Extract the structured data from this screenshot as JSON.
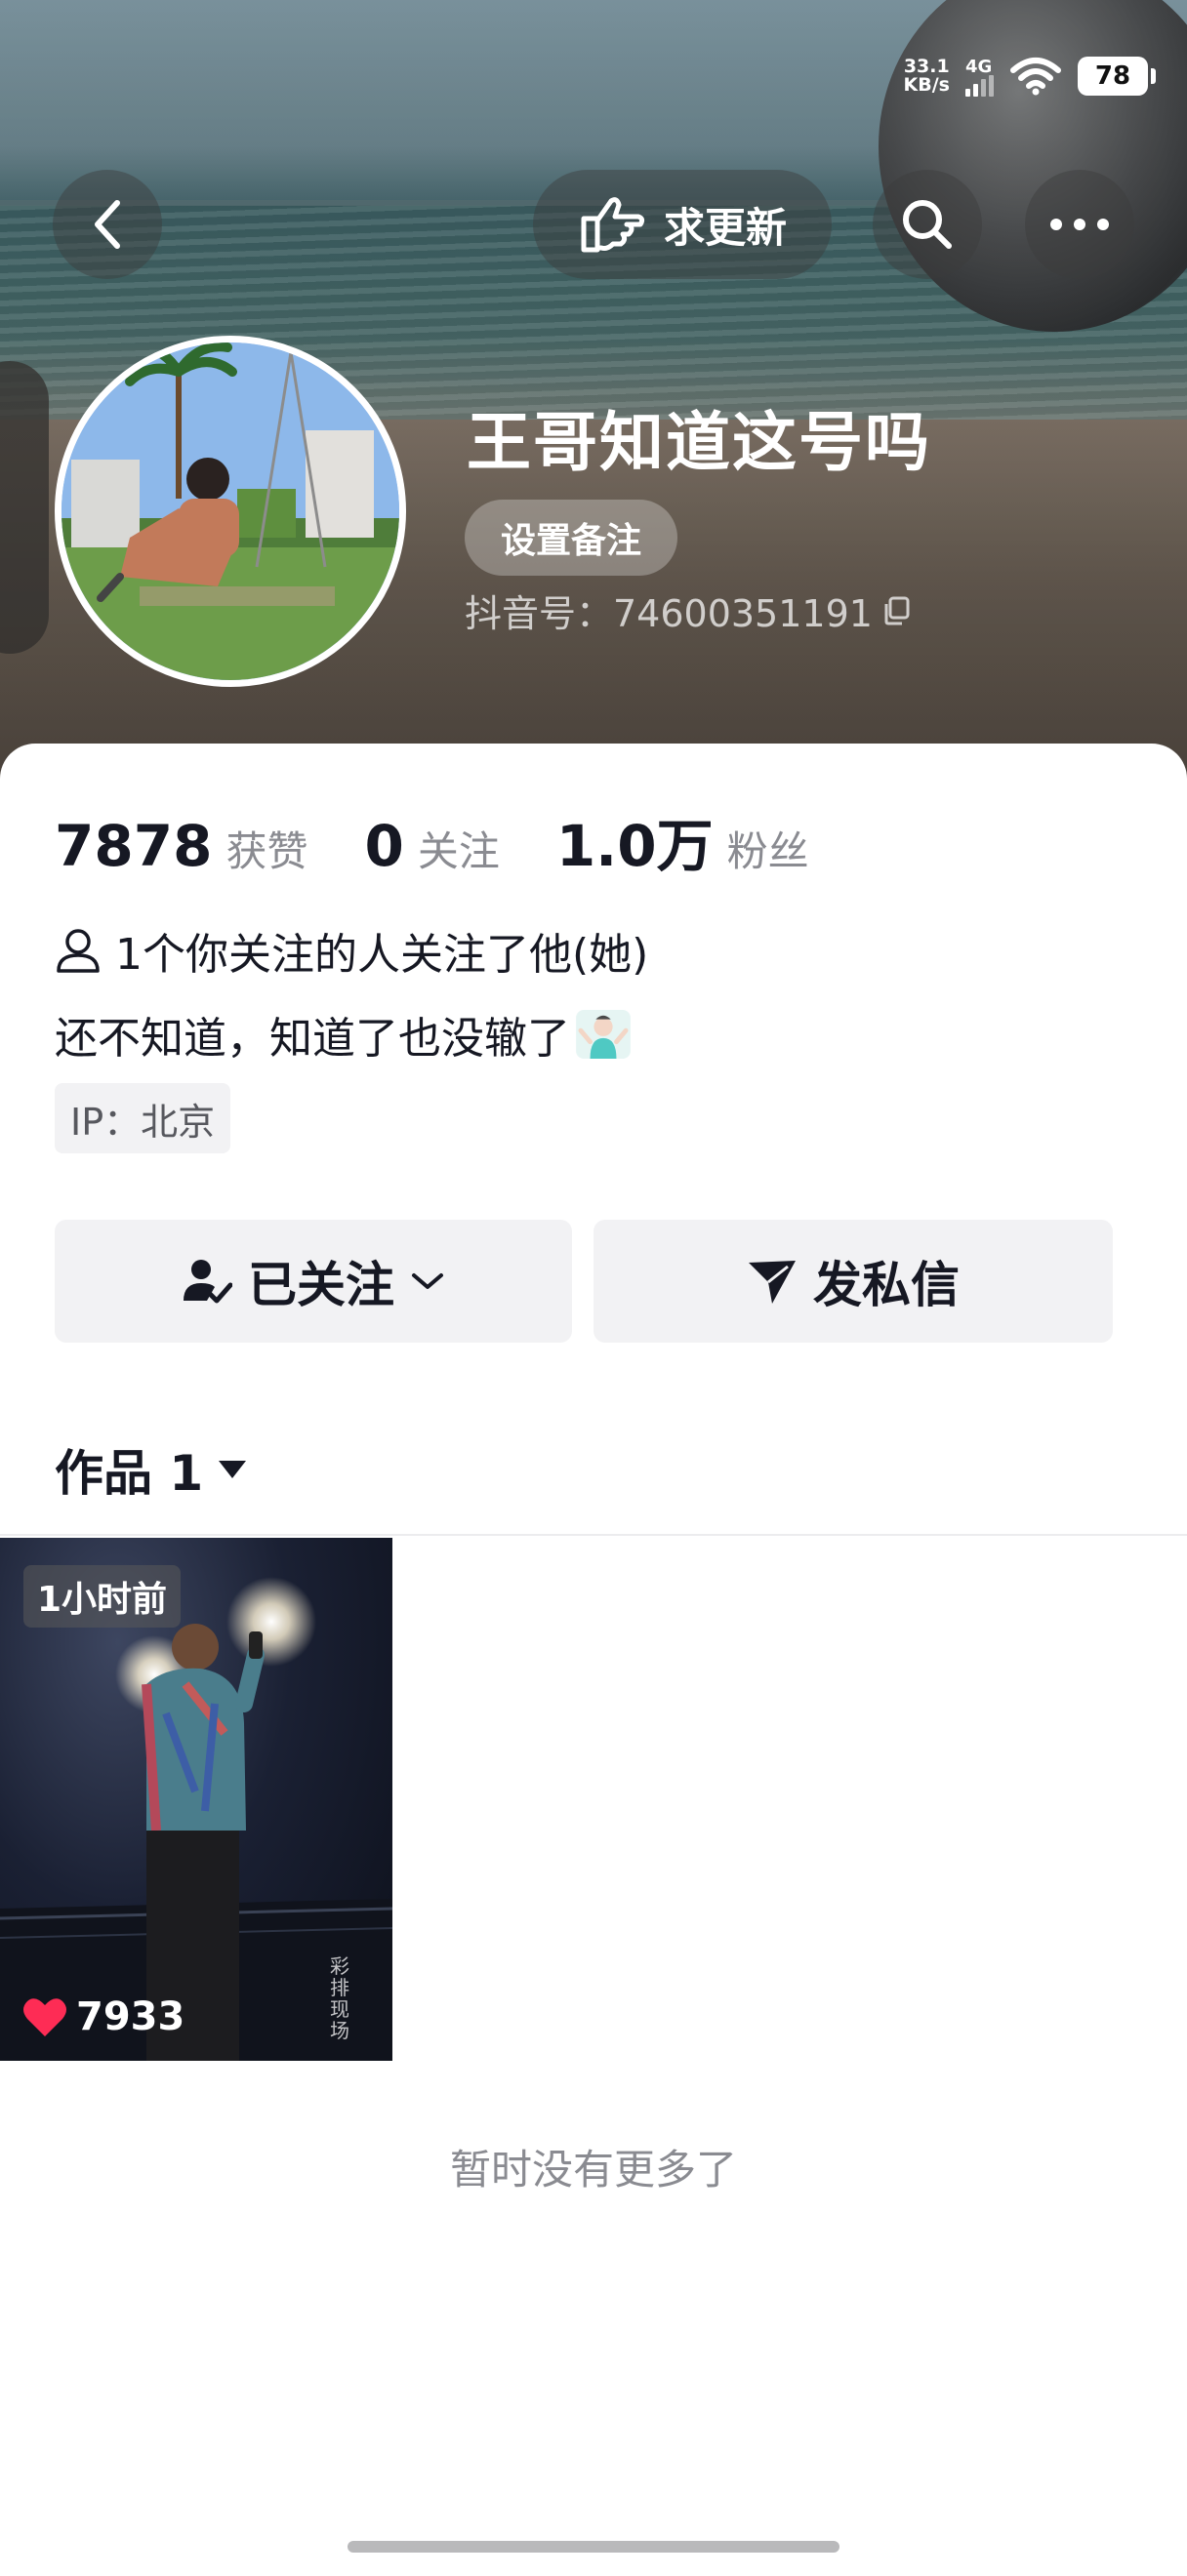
{
  "status_bar": {
    "speed_value": "33.1",
    "speed_unit": "KB/s",
    "network": "4G",
    "battery": "78"
  },
  "nav": {
    "request_update_label": "求更新"
  },
  "profile": {
    "nickname": "王哥知道这号吗",
    "remark_label": "设置备注",
    "douyin_id": "抖音号：74600351191"
  },
  "stats": [
    {
      "value": "7878",
      "label": "获赞"
    },
    {
      "value": "0",
      "label": "关注"
    },
    {
      "value": "1.0万",
      "label": "粉丝"
    }
  ],
  "mutual_follow": "1个你关注的人关注了他(她)",
  "bio": "还不知道，知道了也没辙了",
  "ip": "IP：北京",
  "buttons": {
    "followed": "已关注",
    "message": "发私信"
  },
  "tabs": {
    "works": "作品 1"
  },
  "videos": [
    {
      "time": "1小时前",
      "likes": "7933",
      "watermark": "彩排现场"
    }
  ],
  "footer": {
    "no_more": "暂时没有更多了"
  },
  "colors": {
    "like": "#fe2c55",
    "text": "#161823",
    "muted": "#8a8b91"
  }
}
